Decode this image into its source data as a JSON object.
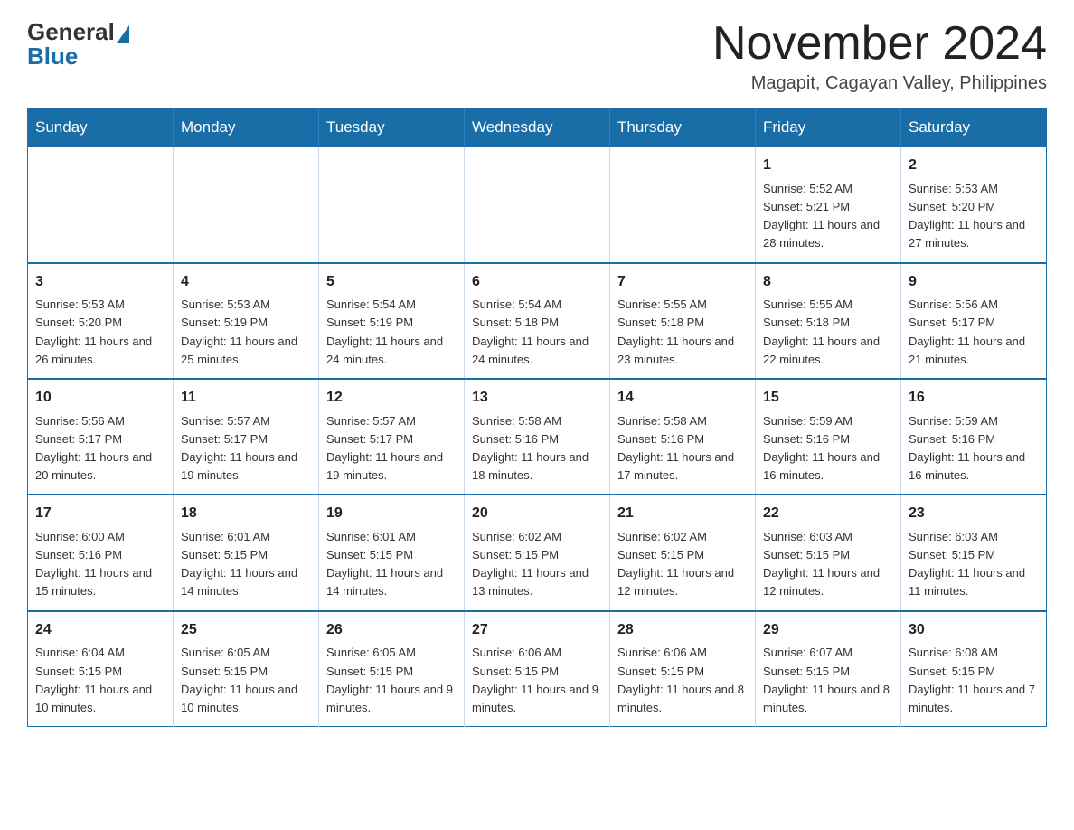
{
  "logo": {
    "general": "General",
    "blue": "Blue"
  },
  "header": {
    "month_title": "November 2024",
    "subtitle": "Magapit, Cagayan Valley, Philippines"
  },
  "weekdays": [
    "Sunday",
    "Monday",
    "Tuesday",
    "Wednesday",
    "Thursday",
    "Friday",
    "Saturday"
  ],
  "weeks": [
    [
      {
        "day": "",
        "info": ""
      },
      {
        "day": "",
        "info": ""
      },
      {
        "day": "",
        "info": ""
      },
      {
        "day": "",
        "info": ""
      },
      {
        "day": "",
        "info": ""
      },
      {
        "day": "1",
        "info": "Sunrise: 5:52 AM\nSunset: 5:21 PM\nDaylight: 11 hours and 28 minutes."
      },
      {
        "day": "2",
        "info": "Sunrise: 5:53 AM\nSunset: 5:20 PM\nDaylight: 11 hours and 27 minutes."
      }
    ],
    [
      {
        "day": "3",
        "info": "Sunrise: 5:53 AM\nSunset: 5:20 PM\nDaylight: 11 hours and 26 minutes."
      },
      {
        "day": "4",
        "info": "Sunrise: 5:53 AM\nSunset: 5:19 PM\nDaylight: 11 hours and 25 minutes."
      },
      {
        "day": "5",
        "info": "Sunrise: 5:54 AM\nSunset: 5:19 PM\nDaylight: 11 hours and 24 minutes."
      },
      {
        "day": "6",
        "info": "Sunrise: 5:54 AM\nSunset: 5:18 PM\nDaylight: 11 hours and 24 minutes."
      },
      {
        "day": "7",
        "info": "Sunrise: 5:55 AM\nSunset: 5:18 PM\nDaylight: 11 hours and 23 minutes."
      },
      {
        "day": "8",
        "info": "Sunrise: 5:55 AM\nSunset: 5:18 PM\nDaylight: 11 hours and 22 minutes."
      },
      {
        "day": "9",
        "info": "Sunrise: 5:56 AM\nSunset: 5:17 PM\nDaylight: 11 hours and 21 minutes."
      }
    ],
    [
      {
        "day": "10",
        "info": "Sunrise: 5:56 AM\nSunset: 5:17 PM\nDaylight: 11 hours and 20 minutes."
      },
      {
        "day": "11",
        "info": "Sunrise: 5:57 AM\nSunset: 5:17 PM\nDaylight: 11 hours and 19 minutes."
      },
      {
        "day": "12",
        "info": "Sunrise: 5:57 AM\nSunset: 5:17 PM\nDaylight: 11 hours and 19 minutes."
      },
      {
        "day": "13",
        "info": "Sunrise: 5:58 AM\nSunset: 5:16 PM\nDaylight: 11 hours and 18 minutes."
      },
      {
        "day": "14",
        "info": "Sunrise: 5:58 AM\nSunset: 5:16 PM\nDaylight: 11 hours and 17 minutes."
      },
      {
        "day": "15",
        "info": "Sunrise: 5:59 AM\nSunset: 5:16 PM\nDaylight: 11 hours and 16 minutes."
      },
      {
        "day": "16",
        "info": "Sunrise: 5:59 AM\nSunset: 5:16 PM\nDaylight: 11 hours and 16 minutes."
      }
    ],
    [
      {
        "day": "17",
        "info": "Sunrise: 6:00 AM\nSunset: 5:16 PM\nDaylight: 11 hours and 15 minutes."
      },
      {
        "day": "18",
        "info": "Sunrise: 6:01 AM\nSunset: 5:15 PM\nDaylight: 11 hours and 14 minutes."
      },
      {
        "day": "19",
        "info": "Sunrise: 6:01 AM\nSunset: 5:15 PM\nDaylight: 11 hours and 14 minutes."
      },
      {
        "day": "20",
        "info": "Sunrise: 6:02 AM\nSunset: 5:15 PM\nDaylight: 11 hours and 13 minutes."
      },
      {
        "day": "21",
        "info": "Sunrise: 6:02 AM\nSunset: 5:15 PM\nDaylight: 11 hours and 12 minutes."
      },
      {
        "day": "22",
        "info": "Sunrise: 6:03 AM\nSunset: 5:15 PM\nDaylight: 11 hours and 12 minutes."
      },
      {
        "day": "23",
        "info": "Sunrise: 6:03 AM\nSunset: 5:15 PM\nDaylight: 11 hours and 11 minutes."
      }
    ],
    [
      {
        "day": "24",
        "info": "Sunrise: 6:04 AM\nSunset: 5:15 PM\nDaylight: 11 hours and 10 minutes."
      },
      {
        "day": "25",
        "info": "Sunrise: 6:05 AM\nSunset: 5:15 PM\nDaylight: 11 hours and 10 minutes."
      },
      {
        "day": "26",
        "info": "Sunrise: 6:05 AM\nSunset: 5:15 PM\nDaylight: 11 hours and 9 minutes."
      },
      {
        "day": "27",
        "info": "Sunrise: 6:06 AM\nSunset: 5:15 PM\nDaylight: 11 hours and 9 minutes."
      },
      {
        "day": "28",
        "info": "Sunrise: 6:06 AM\nSunset: 5:15 PM\nDaylight: 11 hours and 8 minutes."
      },
      {
        "day": "29",
        "info": "Sunrise: 6:07 AM\nSunset: 5:15 PM\nDaylight: 11 hours and 8 minutes."
      },
      {
        "day": "30",
        "info": "Sunrise: 6:08 AM\nSunset: 5:15 PM\nDaylight: 11 hours and 7 minutes."
      }
    ]
  ]
}
